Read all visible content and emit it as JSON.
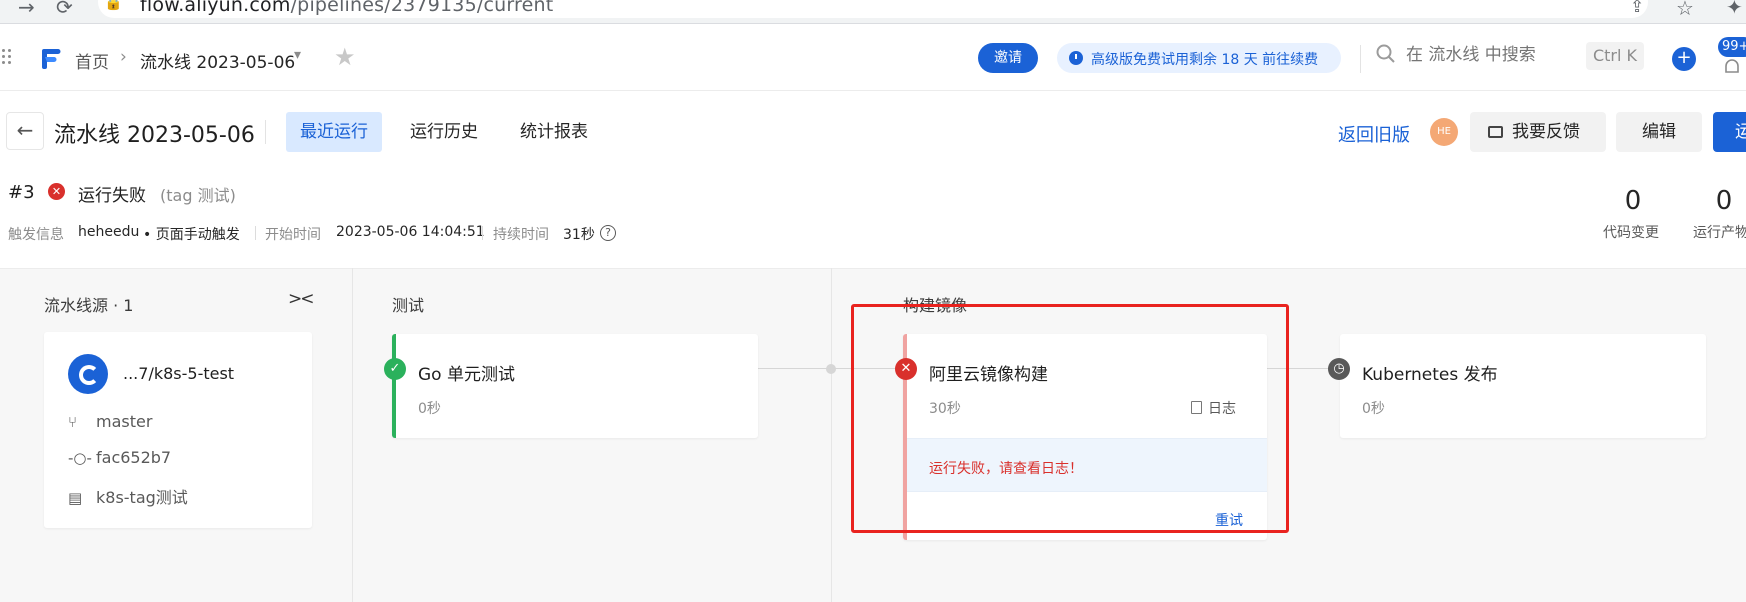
{
  "browser": {
    "url_host": "flow.aliyun.com",
    "url_path": "/pipelines/2379135/current"
  },
  "header": {
    "breadcrumb_home": "首页",
    "breadcrumb_current": "流水线 2023-05-06",
    "invite_label": "邀请",
    "trial_text": "高级版免费试用剩余 18 天",
    "trial_link": "前往续费",
    "search_placeholder": "在 流水线 中搜索",
    "shortcut": "Ctrl K",
    "notification_count": "99+"
  },
  "title_bar": {
    "pipeline_name": "流水线 2023-05-06",
    "tabs": [
      "最近运行",
      "运行历史",
      "统计报表"
    ],
    "active_tab": "最近运行",
    "old_version_label": "返回旧版",
    "avatar_initials": "HE",
    "feedback_label": "我要反馈",
    "edit_label": "编辑",
    "run_label": "运"
  },
  "run": {
    "number": "#3",
    "status": "运行失败",
    "tag": "(tag 测试)",
    "trigger_label": "触发信息",
    "trigger_user": "heheedu",
    "trigger_type": "• 页面手动触发",
    "start_label": "开始时间",
    "start_time": "2023-05-06 14:04:51",
    "duration_label": "持续时间",
    "duration": "31秒",
    "stats": [
      {
        "value": "0",
        "label": "代码变更"
      },
      {
        "value": "0",
        "label": "运行产物"
      }
    ]
  },
  "stages": {
    "source": {
      "title": "流水线源 · 1",
      "repo": "...7/k8s-5-test",
      "branch": "master",
      "commit": "fac652b7",
      "message": "k8s-tag测试"
    },
    "test": {
      "title": "测试",
      "job_name": "Go 单元测试",
      "duration": "0秒",
      "status": "success"
    },
    "build": {
      "title": "构建镜像",
      "job_name": "阿里云镜像构建",
      "duration": "30秒",
      "log_label": "日志",
      "error_message": "运行失败，请查看日志！",
      "retry_label": "重试",
      "status": "failed"
    },
    "deploy": {
      "job_name": "Kubernetes 发布",
      "duration": "0秒",
      "status": "pending"
    }
  },
  "colors": {
    "primary": "#1b62d6",
    "success": "#2bb15c",
    "danger": "#d9302c",
    "pending": "#595959",
    "highlight": "#e9231f"
  }
}
